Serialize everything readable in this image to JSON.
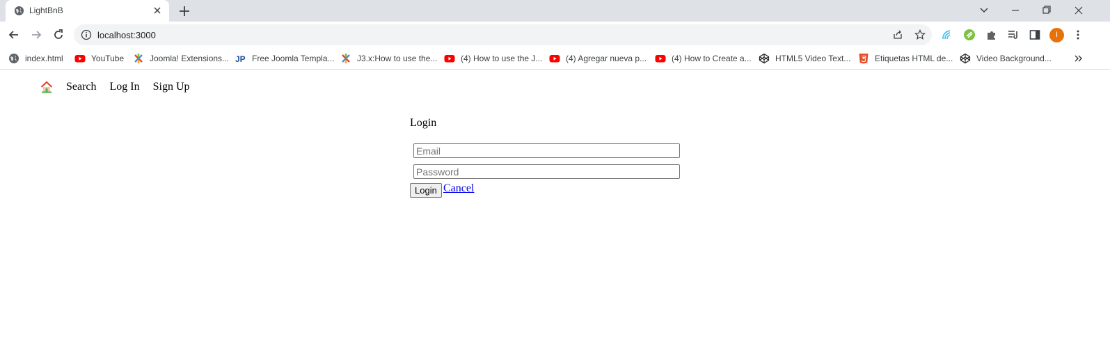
{
  "browser": {
    "tab": {
      "title": "LightBnB"
    },
    "address": {
      "url": "localhost:3000"
    },
    "avatar_letter": "I",
    "colors": {
      "tab_strip": "#dee1e6",
      "omnibox": "#f1f3f4",
      "avatar": "#e8710a"
    },
    "bookmarks": [
      {
        "label": "index.html",
        "icon": "globe-icon"
      },
      {
        "label": "YouTube",
        "icon": "youtube-icon"
      },
      {
        "label": "Joomla! Extensions...",
        "icon": "joomla-icon"
      },
      {
        "label": "Free Joomla Templa...",
        "icon": "jp-icon"
      },
      {
        "label": "J3.x:How to use the...",
        "icon": "joomla-icon"
      },
      {
        "label": "(4) How to use the J...",
        "icon": "youtube-icon"
      },
      {
        "label": "(4) Agregar nueva p...",
        "icon": "youtube-icon"
      },
      {
        "label": "(4) How to Create a...",
        "icon": "youtube-icon"
      },
      {
        "label": "HTML5 Video Text...",
        "icon": "codepen-icon"
      },
      {
        "label": "Etiquetas HTML de...",
        "icon": "html5-icon"
      },
      {
        "label": "Video Background...",
        "icon": "codepen-icon"
      }
    ]
  },
  "site": {
    "nav": {
      "search": "Search",
      "login": "Log In",
      "signup": "Sign Up"
    },
    "login_form": {
      "heading": "Login",
      "email_placeholder": "Email",
      "email_value": "",
      "password_placeholder": "Password",
      "password_value": "",
      "submit_label": "Login",
      "cancel_label": "Cancel"
    },
    "link_color": "#0000ee"
  }
}
